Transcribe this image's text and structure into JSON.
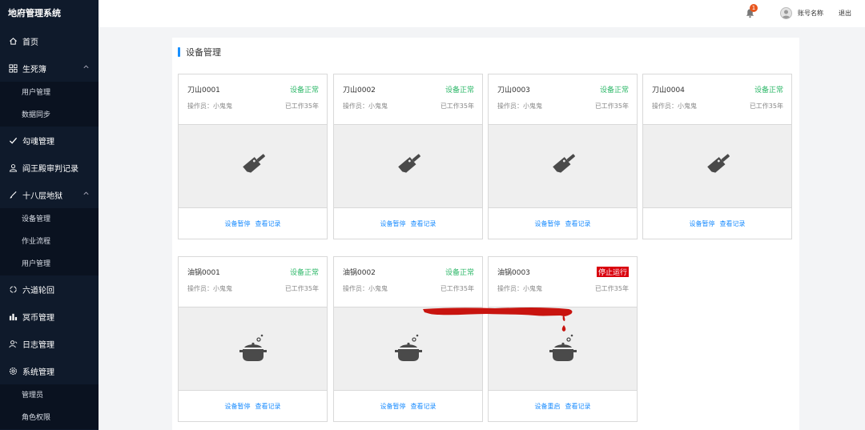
{
  "app": {
    "title": "地府管理系统"
  },
  "sidebar": {
    "items": [
      {
        "label": "首页",
        "icon": "home-icon"
      },
      {
        "label": "生死簿",
        "icon": "grid-icon",
        "expanded": true,
        "children": [
          {
            "label": "用户管理"
          },
          {
            "label": "数据同步"
          }
        ]
      },
      {
        "label": "勾魂管理",
        "icon": "check-icon"
      },
      {
        "label": "阎王殿审判记录",
        "icon": "person-icon"
      },
      {
        "label": "十八层地狱",
        "icon": "brush-icon",
        "expanded": true,
        "children": [
          {
            "label": "设备管理"
          },
          {
            "label": "作业流程"
          },
          {
            "label": "用户管理"
          }
        ]
      },
      {
        "label": "六道轮回",
        "icon": "cycle-icon"
      },
      {
        "label": "冥币管理",
        "icon": "coins-icon"
      },
      {
        "label": "日志管理",
        "icon": "user-log-icon"
      },
      {
        "label": "系统管理",
        "icon": "gear-icon",
        "expanded": true,
        "children": [
          {
            "label": "管理员"
          },
          {
            "label": "角色权限"
          }
        ]
      }
    ]
  },
  "header": {
    "notification_count": "1",
    "account_label": "账号名称",
    "logout_label": "退出"
  },
  "main": {
    "section_title": "设备管理",
    "cards": [
      {
        "name": "刀山0001",
        "status": "设备正常",
        "operator": "操作员：小鬼鬼",
        "worked": "已工作35年",
        "icon": "cleaver-icon",
        "action1": "设备暂停",
        "action2": "查看记录"
      },
      {
        "name": "刀山0002",
        "status": "设备正常",
        "operator": "操作员：小鬼鬼",
        "worked": "已工作35年",
        "icon": "cleaver-icon",
        "action1": "设备暂停",
        "action2": "查看记录"
      },
      {
        "name": "刀山0003",
        "status": "设备正常",
        "operator": "操作员：小鬼鬼",
        "worked": "已工作35年",
        "icon": "cleaver-icon",
        "action1": "设备暂停",
        "action2": "查看记录"
      },
      {
        "name": "刀山0004",
        "status": "设备正常",
        "operator": "操作员：小鬼鬼",
        "worked": "已工作35年",
        "icon": "cleaver-icon",
        "action1": "设备暂停",
        "action2": "查看记录"
      },
      {
        "name": "油锅0001",
        "status": "设备正常",
        "operator": "操作员：小鬼鬼",
        "worked": "已工作35年",
        "icon": "cooking-pot-icon",
        "action1": "设备暂停",
        "action2": "查看记录"
      },
      {
        "name": "油锅0002",
        "status": "设备正常",
        "operator": "操作员：小鬼鬼",
        "worked": "已工作35年",
        "icon": "cooking-pot-icon",
        "action1": "设备暂停",
        "action2": "查看记录"
      },
      {
        "name": "油锅0003",
        "status": "停止运行",
        "status_type": "stopped",
        "operator": "操作员：小鬼鬼",
        "worked": "已工作35年",
        "icon": "cooking-pot-icon",
        "action1": "设备重启",
        "action2": "查看记录"
      }
    ]
  },
  "colors": {
    "sidebar_bg": "#0f1a2b",
    "status_ok": "#2fb86a",
    "status_stopped": "#d9000d",
    "link": "#1a8cff",
    "accent": "#1890ff"
  }
}
